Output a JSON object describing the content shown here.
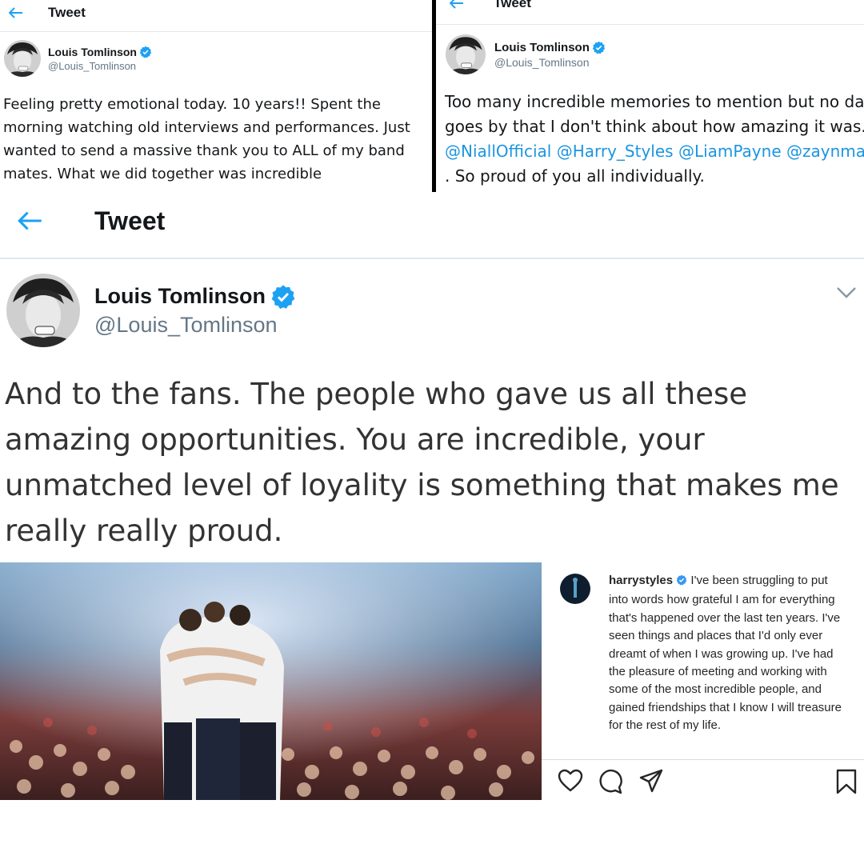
{
  "colors": {
    "accent": "#1da1f2",
    "mention": "#1b95e0",
    "verified": "#1da1f2",
    "text": "#14171a",
    "muted": "#657786"
  },
  "tweet_top_left": {
    "header_title": "Tweet",
    "author": {
      "display_name": "Louis Tomlinson",
      "handle": "@Louis_Tomlinson",
      "verified": true
    },
    "text": "Feeling pretty emotional today. 10 years!! Spent the morning watching old interviews and performances. Just wanted to send a massive thank you to ALL of my band mates. What we did together was incredible"
  },
  "tweet_top_right": {
    "header_title": "Tweet",
    "author": {
      "display_name": "Louis Tomlinson",
      "handle": "@Louis_Tomlinson",
      "verified": true
    },
    "text_before": "Too many incredible memories to mention but no day goes by that I don't think about how amazing it was.",
    "mentions": [
      "@NiallOfficial",
      "@Harry_Styles",
      "@LiamPayne",
      "@zaynmalik"
    ],
    "text_after": ". So proud of you all individually."
  },
  "tweet_main": {
    "header_title": "Tweet",
    "author": {
      "display_name": "Louis Tomlinson",
      "handle": "@Louis_Tomlinson",
      "verified": true
    },
    "text": "And to the fans. The people who gave us all these amazing opportunities. You are incredible, your unmatched level of loyality is something that makes me really really proud.",
    "media": {
      "instagram": {
        "username": "harrystyles",
        "verified": true,
        "caption": "I've been struggling to put into words how grateful I am for everything that's happened over the last ten years. I've seen things and places that I'd only ever dreamt of when I was growing up. I've had the pleasure of meeting and working with some of the most incredible people, and gained friendships that I know I will treasure for the rest of my life.",
        "actions": [
          "heart-icon",
          "comment-icon",
          "share-icon",
          "bookmark-icon"
        ]
      }
    }
  }
}
